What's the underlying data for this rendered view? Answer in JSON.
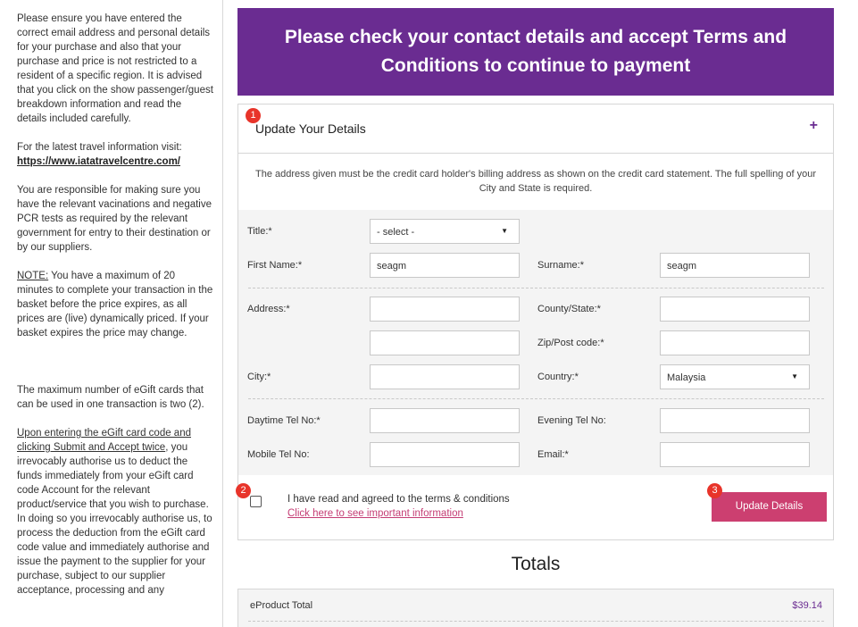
{
  "sidebar": {
    "p1": "Please ensure you have entered the correct email address and personal details for your purchase and also that your purchase and price is not restricted to a resident of a specific region. It is advised that you click on the show passenger/guest breakdown information and read the details included carefully.",
    "p2_prefix": "For the latest travel information visit: ",
    "p2_link": "https://www.iatatravelcentre.com/",
    "p3": "You are responsible for making sure you have the relevant vacinations and negative PCR tests as required by the relevant government for entry to their destination or by our suppliers.",
    "p4_note": "NOTE:",
    "p4_rest": " You have a maximum of 20 minutes to complete your transaction in the basket before the price expires, as all prices are (live) dynamically priced. If your basket expires the price may change.",
    "p5": "The maximum number of eGift cards that can be used in one transaction is two (2).",
    "p6_underlined": "Upon entering the eGift card code and clicking Submit and Accept twice",
    "p6_rest": ", you irrevocably authorise us to deduct the funds immediately from your eGift card code Account for the relevant product/service that you wish to purchase. In doing so you irrevocably authorise us, to process the deduction from the eGift card code value and immediately authorise and issue the payment to the supplier for your purchase, subject to our supplier acceptance, processing and any"
  },
  "banner": {
    "line1": "Please check your contact details and accept Terms and",
    "line2": "Conditions to continue to payment"
  },
  "panel": {
    "title": "Update Your Details",
    "toggle": "+",
    "notice": "The address given must be the credit card holder's billing address as shown on the credit card statement. The full spelling of your City and State is required."
  },
  "form": {
    "title_label": "Title:*",
    "title_value": "- select -",
    "first_name_label": "First Name:*",
    "first_name_value": "seagm",
    "surname_label": "Surname:*",
    "surname_value": "seagm",
    "address_label": "Address:*",
    "address1_value": "",
    "address2_value": "",
    "county_label": "County/State:*",
    "county_value": "",
    "zip_label": "Zip/Post code:*",
    "zip_value": "",
    "city_label": "City:*",
    "city_value": "",
    "country_label": "Country:*",
    "country_value": "Malaysia",
    "daytime_label": "Daytime Tel No:*",
    "daytime_value": "",
    "evening_label": "Evening Tel No:",
    "evening_value": "",
    "mobile_label": "Mobile Tel No:",
    "mobile_value": "",
    "email_label": "Email:*",
    "email_value": ""
  },
  "terms": {
    "text": "I have read and agreed to the terms & conditions",
    "link": "Click here to see important information",
    "button": "Update Details"
  },
  "badges": {
    "b1": "1",
    "b2": "2",
    "b3": "3"
  },
  "totals": {
    "title": "Totals",
    "eproduct_label": "eProduct Total",
    "eproduct_value": "$39.14"
  },
  "colors": {
    "brand_purple": "#6a2c91",
    "button_pink": "#cc3f70",
    "badge_red": "#e8342a"
  }
}
